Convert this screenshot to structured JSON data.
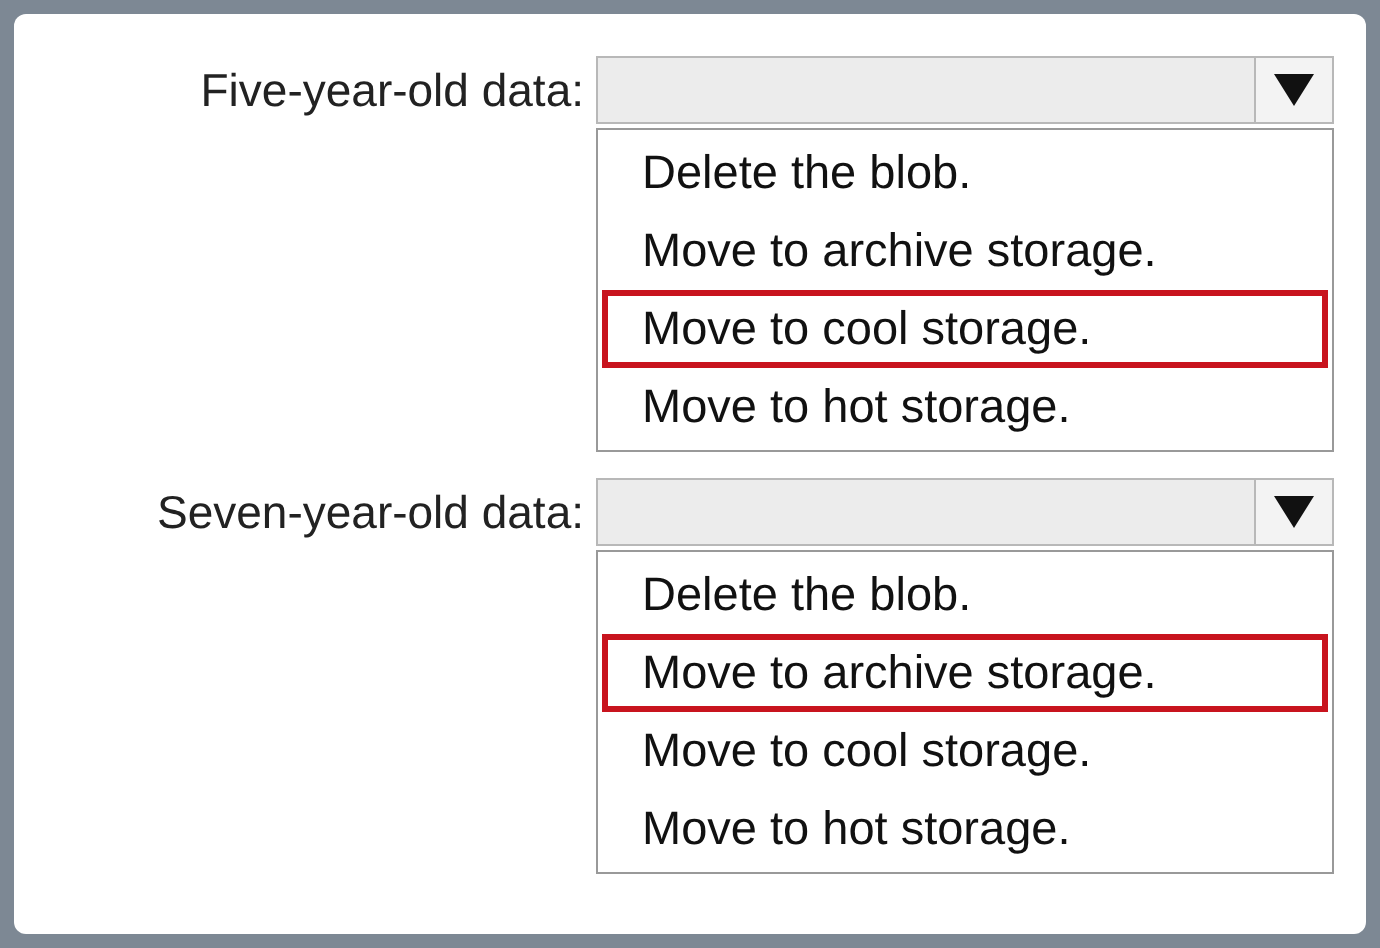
{
  "questions": [
    {
      "label": "Five-year-old data:",
      "options": [
        {
          "text": "Delete the blob.",
          "selected": false
        },
        {
          "text": "Move to archive storage.",
          "selected": false
        },
        {
          "text": "Move to cool storage.",
          "selected": true
        },
        {
          "text": "Move to hot storage.",
          "selected": false
        }
      ]
    },
    {
      "label": "Seven-year-old data:",
      "options": [
        {
          "text": "Delete the blob.",
          "selected": false
        },
        {
          "text": "Move to archive storage.",
          "selected": true
        },
        {
          "text": "Move to cool storage.",
          "selected": false
        },
        {
          "text": "Move to hot storage.",
          "selected": false
        }
      ]
    }
  ]
}
